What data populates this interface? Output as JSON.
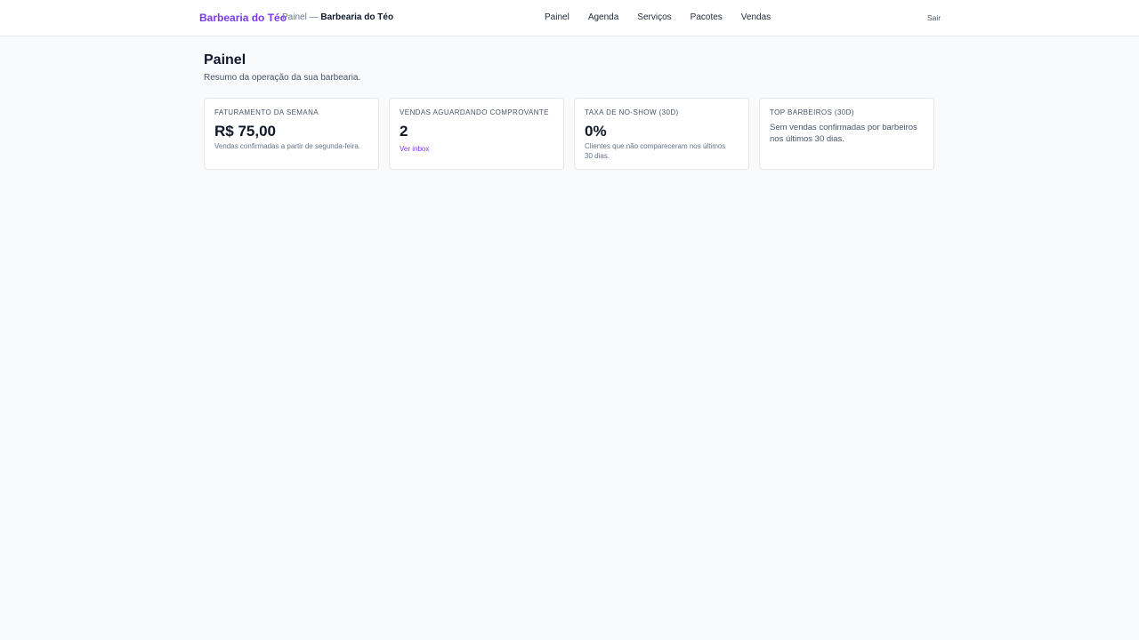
{
  "header": {
    "brand": "Barbearia do Téo",
    "crumb_prefix": "Painel — ",
    "crumb_current": "Barbearia do Téo",
    "nav": [
      "Painel",
      "Agenda",
      "Serviços",
      "Pacotes",
      "Vendas"
    ],
    "logout": "Sair"
  },
  "page": {
    "title": "Painel",
    "subtitle": "Resumo da operação da sua barbearia."
  },
  "cards": {
    "revenue": {
      "title": "FATURAMENTO DA SEMANA",
      "value": "R$ 75,00",
      "note": "Vendas confirmadas a partir de segunda-feira."
    },
    "pending": {
      "title": "VENDAS AGUARDANDO COMPROVANTE",
      "value": "2",
      "link": "Ver inbox"
    },
    "noshow": {
      "title": "TAXA DE NO-SHOW (30D)",
      "value": "0%",
      "note": "Clientes que não compareceram nos últimos 30 dias."
    },
    "top": {
      "title": "TOP BARBEIROS (30D)",
      "text": "Sem vendas confirmadas por barbeiros nos últimos 30 dias."
    }
  },
  "colors": {
    "accent": "#7c3aed",
    "background": "#f8fafc"
  }
}
